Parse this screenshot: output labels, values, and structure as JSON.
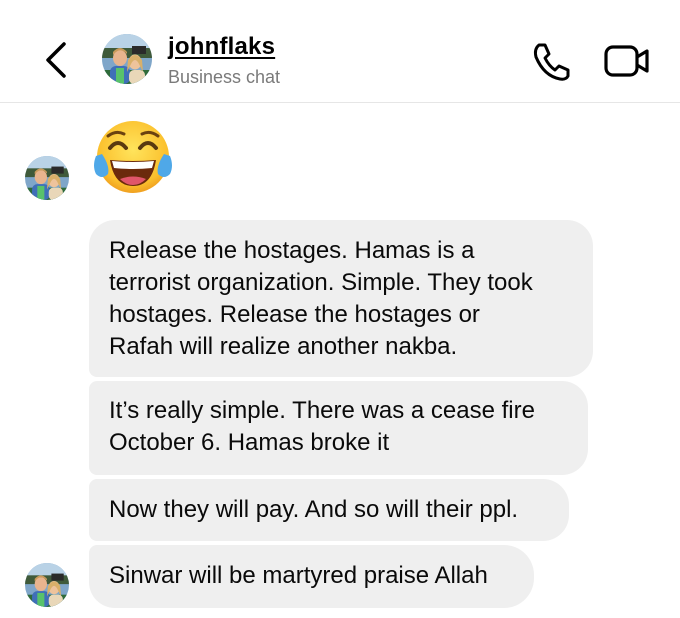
{
  "header": {
    "username": "johnflaks",
    "subtitle": "Business chat",
    "back_icon": "chevron-left-icon",
    "call_icon": "phone-icon",
    "video_icon": "video-camera-icon"
  },
  "emoji_message": {
    "emoji": "face-with-tears-of-joy"
  },
  "messages": [
    {
      "lines": [
        "Release the hostages. Hamas is a",
        "terrorist organization. Simple. They took",
        "hostages. Release the hostages or",
        "Rafah will realize another nakba."
      ]
    },
    {
      "lines": [
        "It’s really simple. There was a cease fire",
        "October 6. Hamas broke it"
      ]
    },
    {
      "lines": [
        "Now they will pay. And so will their ppl."
      ]
    },
    {
      "lines": [
        "Sinwar will be martyred praise Allah"
      ]
    }
  ],
  "colors": {
    "bubble": "#efefef",
    "subtitle": "#7a7a7a",
    "divider": "#e6e6e6"
  }
}
